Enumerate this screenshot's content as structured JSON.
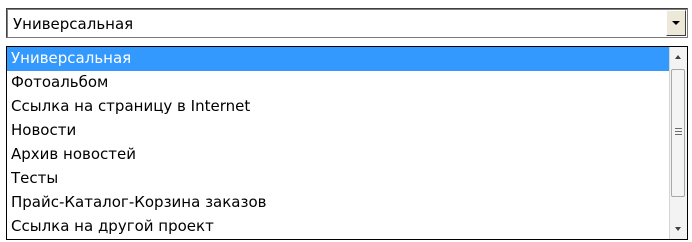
{
  "select": {
    "value": "Универсальная"
  },
  "options": [
    "Универсальная",
    "Фотоальбом",
    "Ссылка на страницу в Internet",
    "Новости",
    "Архив новостей",
    "Тесты",
    "Прайс-Каталог-Корзина заказов",
    "Ссылка на другой проект"
  ],
  "selected_index": 0,
  "icons": {
    "dropdown_arrow": "chevron-down-icon",
    "scroll_up": "scroll-up-arrow-icon",
    "scroll_down": "scroll-down-arrow-icon"
  },
  "colors": {
    "selection_background": "#3399ff",
    "selection_text": "#ffffff"
  }
}
